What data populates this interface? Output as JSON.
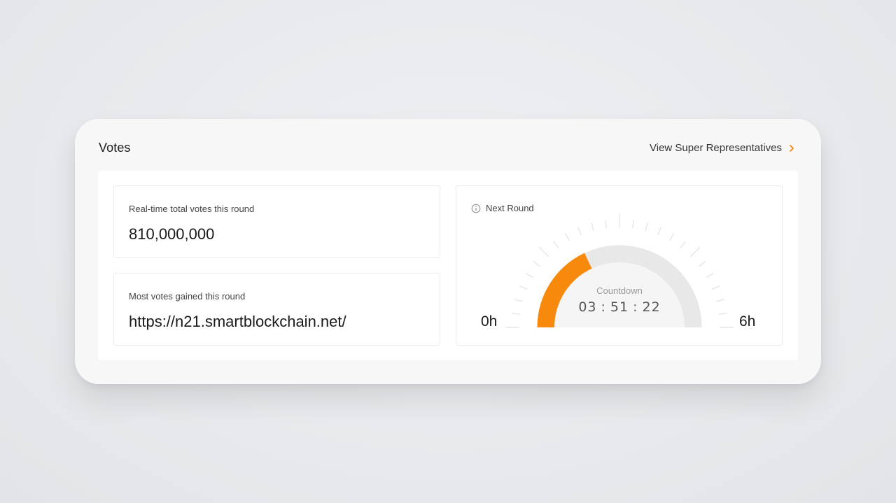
{
  "header": {
    "title": "Votes",
    "view_link_label": "View Super Representatives"
  },
  "stats": {
    "total_votes_label": "Real-time total votes this round",
    "total_votes_value": "810,000,000",
    "most_votes_label": "Most votes gained this round",
    "most_votes_value": "https://n21.smartblockchain.net/"
  },
  "next_round": {
    "label": "Next Round",
    "axis_min": "0h",
    "axis_max": "6h",
    "countdown_label": "Countdown",
    "countdown_hours": "03",
    "countdown_minutes": "51",
    "countdown_seconds": "22",
    "countdown_separator": ":",
    "progress_fraction": 0.36
  },
  "icons": {
    "link_chevron": "chevron-right-icon",
    "next_round_info": "info-icon"
  },
  "colors": {
    "accent": "#f78a0c",
    "track": "#e8e8e8",
    "inner_disc": "#f5f5f5",
    "tick": "#e2e2e2"
  }
}
